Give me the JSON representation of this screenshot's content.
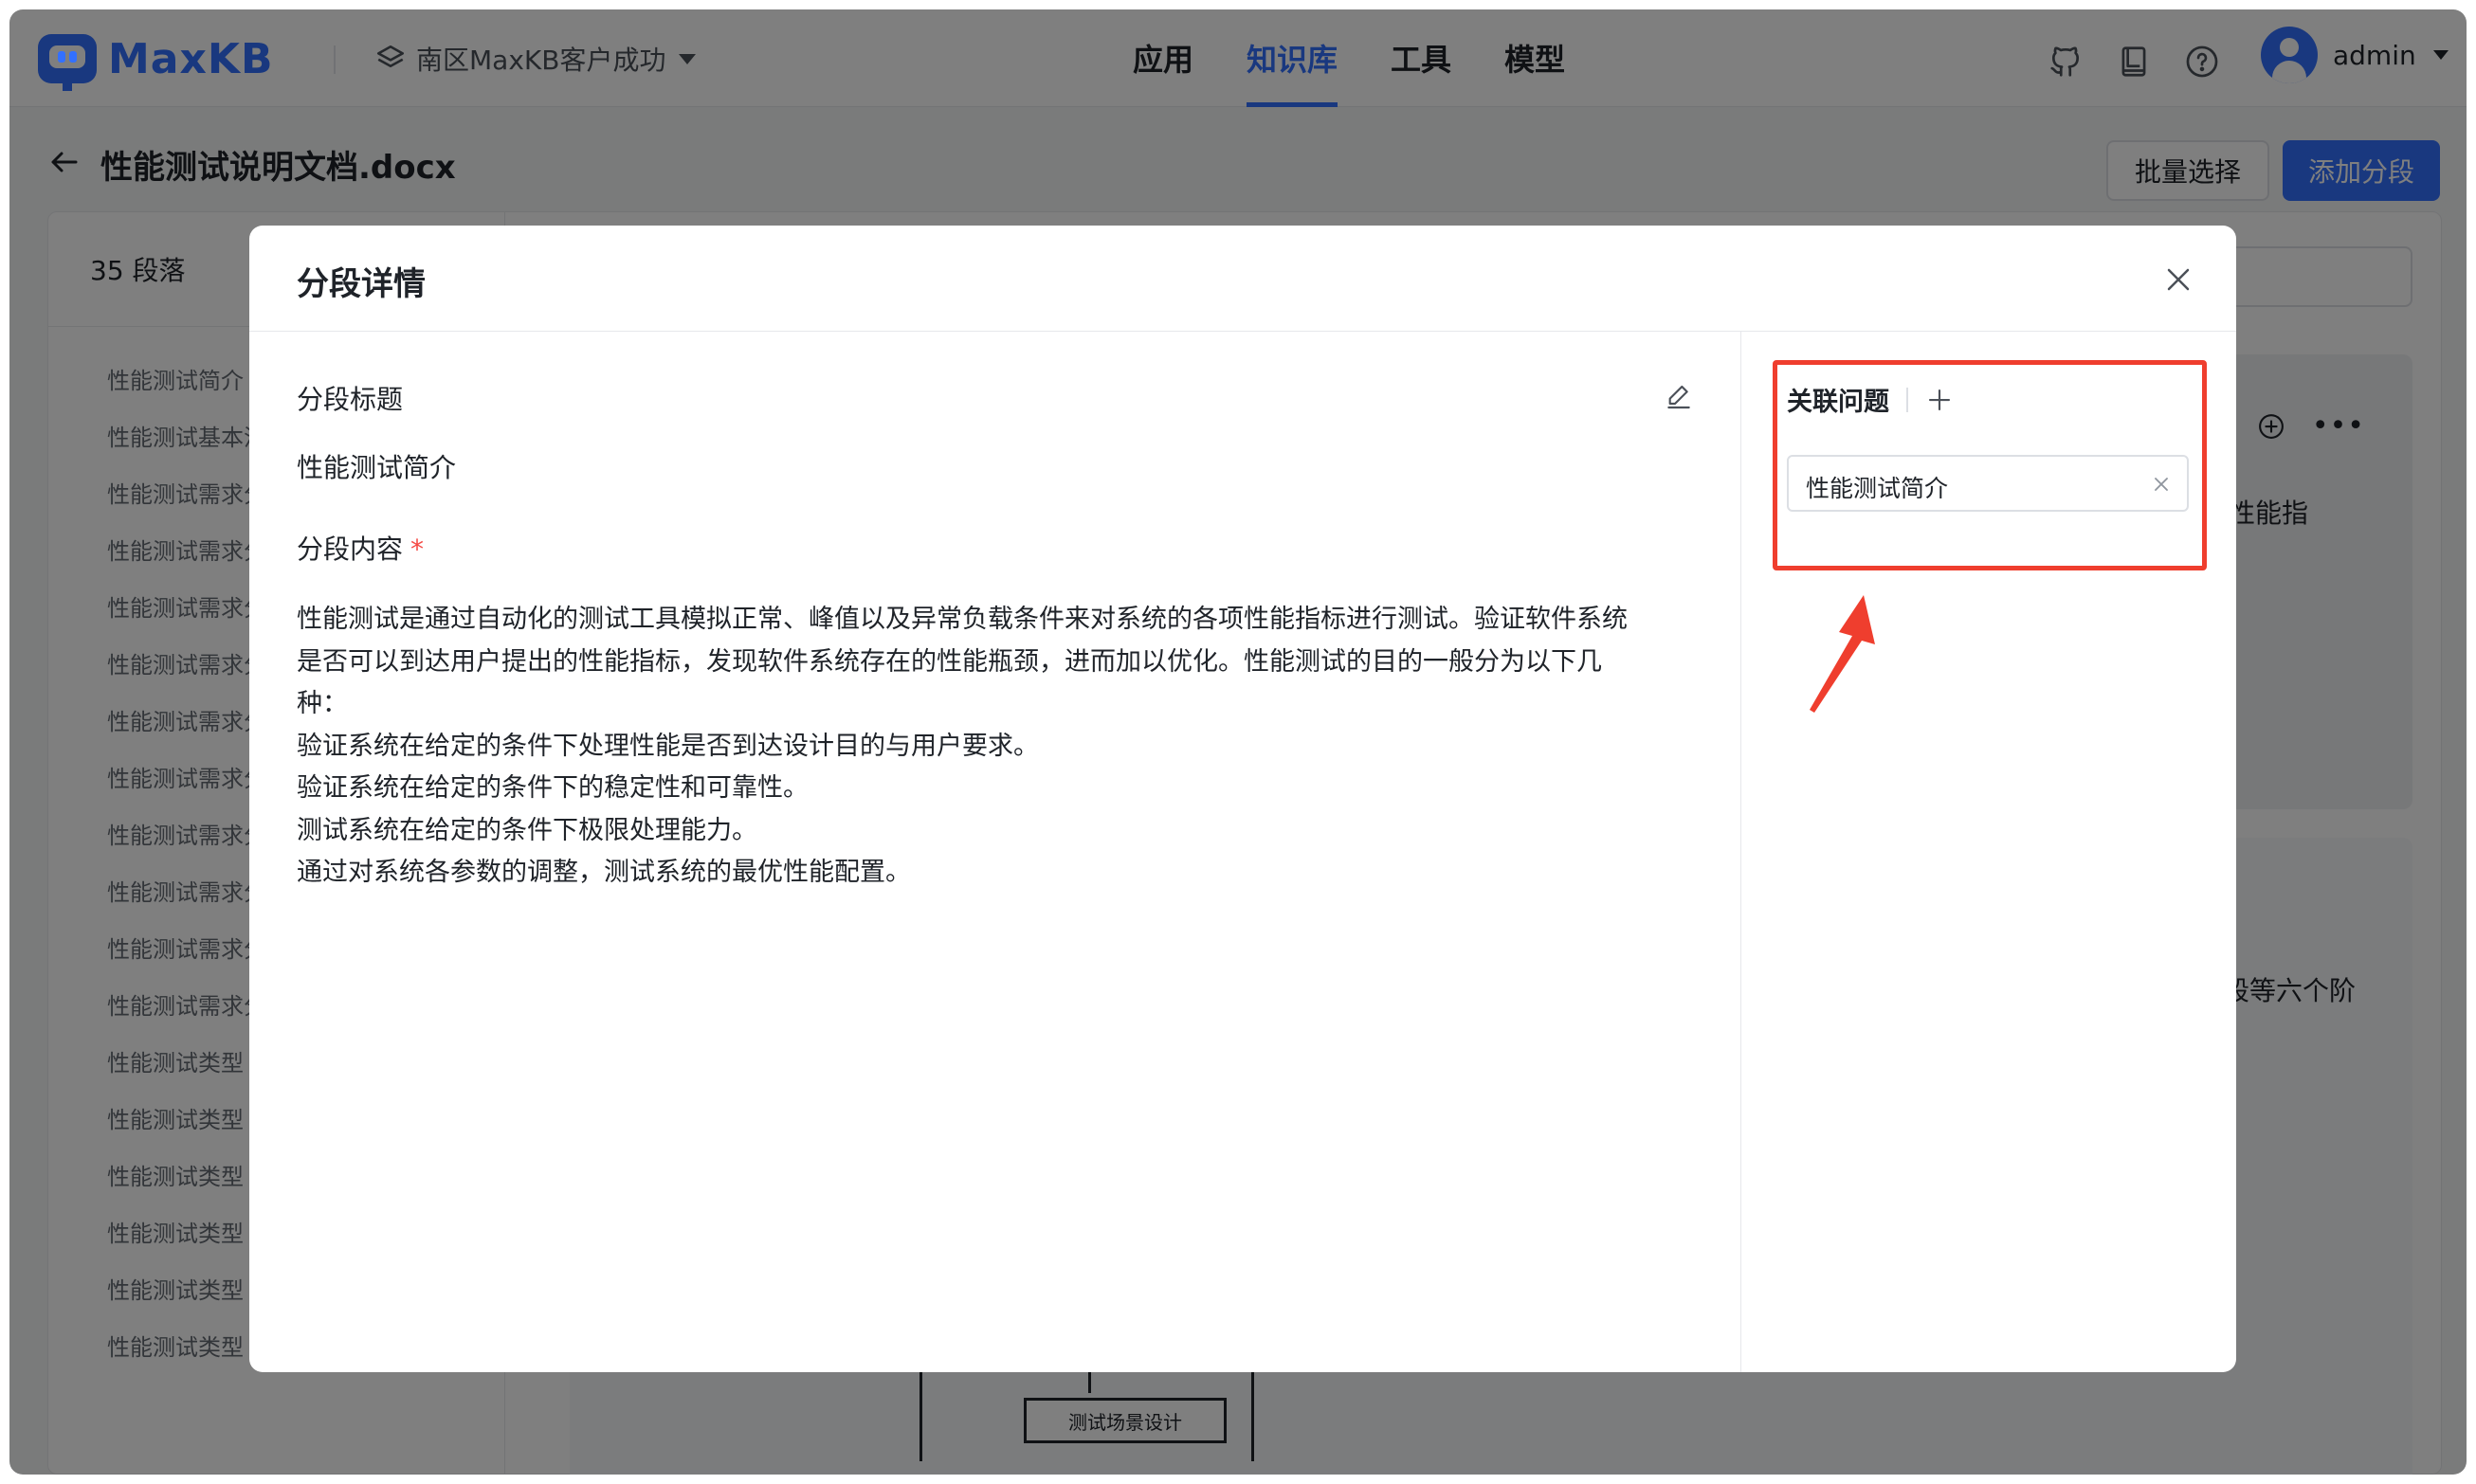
{
  "app": {
    "logo_text": "MaxKB",
    "workspace": "南区MaxKB客户成功",
    "nav": [
      {
        "label": "应用",
        "active": false
      },
      {
        "label": "知识库",
        "active": true
      },
      {
        "label": "工具",
        "active": false
      },
      {
        "label": "模型",
        "active": false
      }
    ],
    "top_icons": [
      "github-icon",
      "book-icon",
      "help-icon"
    ],
    "user_name": "admin",
    "accent_color": "#3370ff"
  },
  "document": {
    "title": "性能测试说明文档.docx",
    "batch_select_label": "批量选择",
    "add_segment_label": "添加分段",
    "paragraph_count": "35 段落",
    "list_items": [
      "性能测试简介",
      "性能测试基本流程",
      "性能测试需求分析",
      "性能测试需求分析",
      "性能测试需求分析",
      "性能测试需求分析",
      "性能测试需求分析",
      "性能测试需求分析",
      "性能测试需求分析",
      "性能测试需求分析",
      "性能测试需求分析",
      "性能测试需求分析",
      "性能测试类型",
      "性能测试类型",
      "性能测试类型",
      "性能测试类型",
      "性能测试类型",
      "性能测试类型"
    ],
    "bg_card1_text": "的性能指",
    "bg_card2_text": "分段等六个阶",
    "flow_box_label": "测试场景设计"
  },
  "modal": {
    "title": "分段详情",
    "segment_title_label": "分段标题",
    "segment_title_value": "性能测试简介",
    "segment_content_label": "分段内容",
    "required_mark": "*",
    "content_lines": [
      "性能测试是通过自动化的测试工具模拟正常、峰值以及异常负载条件来对系统的各项性能指标进行测试。验证软件系统",
      "是否可以到达用户提出的性能指标，发现软件系统存在的性能瓶颈，进而加以优化。性能测试的目的一般分为以下几",
      "种：",
      "验证系统在给定的条件下处理性能是否到达设计目的与用户要求。",
      "验证系统在给定的条件下的稳定性和可靠性。",
      "测试系统在给定的条件下极限处理能力。",
      "通过对系统各参数的调整，测试系统的最优性能配置。"
    ],
    "related_questions_label": "关联问题",
    "questions": [
      "性能测试简介"
    ],
    "highlight_color": "#ef3e2e"
  }
}
